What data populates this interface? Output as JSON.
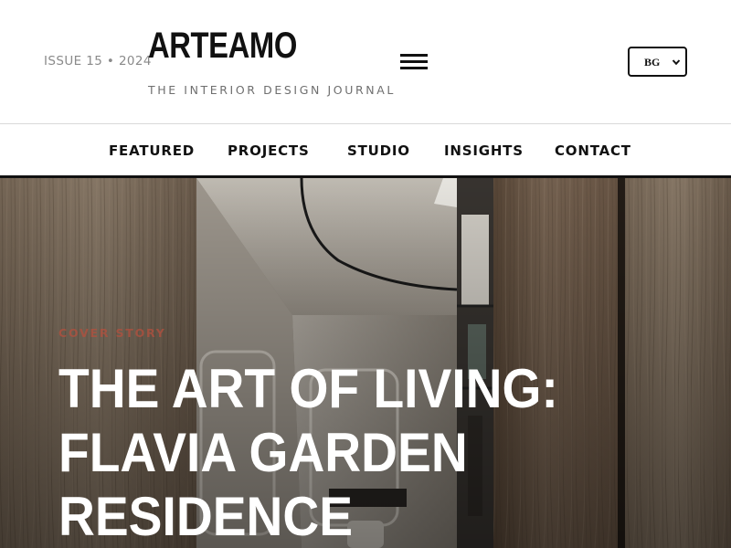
{
  "header": {
    "issue_label": "ISSUE 15 • 2024",
    "logo_text": "ARTEAMO",
    "tagline": "THE INTERIOR DESIGN JOURNAL",
    "menu_icon": "hamburger-menu-icon",
    "language": {
      "selected": "BG",
      "chevron_icon": "chevron-down-icon"
    }
  },
  "nav": {
    "items": [
      {
        "label": "FEATURED"
      },
      {
        "label": "PROJECTS"
      },
      {
        "label": "STUDIO"
      },
      {
        "label": "INSIGHTS"
      },
      {
        "label": "CONTACT"
      }
    ]
  },
  "hero": {
    "kicker": "COVER STORY",
    "headline_lines": [
      "THE ART OF LIVING:",
      "FLAVIA GARDEN",
      "RESIDENCE"
    ]
  },
  "colors": {
    "text": "#111111",
    "muted": "#8a8a8a",
    "kicker": "#b4503e",
    "headline": "#ffffff",
    "wood": "#6e5a47"
  }
}
